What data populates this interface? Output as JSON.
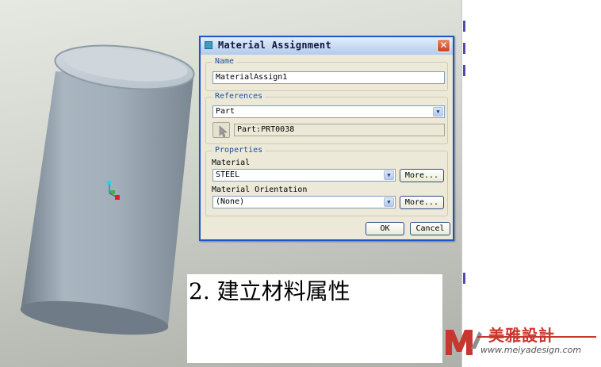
{
  "dialog": {
    "title": "Material Assignment",
    "close_symbol": "✕",
    "name_group": {
      "legend": "Name",
      "value": "MaterialAssign1"
    },
    "references_group": {
      "legend": "References",
      "selected_type": "Part",
      "reference_value": "Part:PRT0038"
    },
    "properties_group": {
      "legend": "Properties",
      "material_label": "Material",
      "material_value": "STEEL",
      "material_more": "More...",
      "orientation_label": "Material Orientation",
      "orientation_value": "(None)",
      "orientation_more": "More..."
    },
    "ok_label": "OK",
    "cancel_label": "Cancel"
  },
  "caption": "2. 建立材料属性",
  "watermark": {
    "brand": "美雅設計",
    "url": "www.meiyadesign.com"
  },
  "colors": {
    "dialog_border": "#1e55c8",
    "dialog_bg": "#ece9d8",
    "cylinder": "#9aa8b4",
    "logo_red": "#c8372d"
  },
  "icons": {
    "title": "dialog-window-icon",
    "close": "close-icon",
    "select_arrow": "chevron-down-icon",
    "pick": "arrow-cursor-icon",
    "csys": "coordinate-system-icon"
  }
}
